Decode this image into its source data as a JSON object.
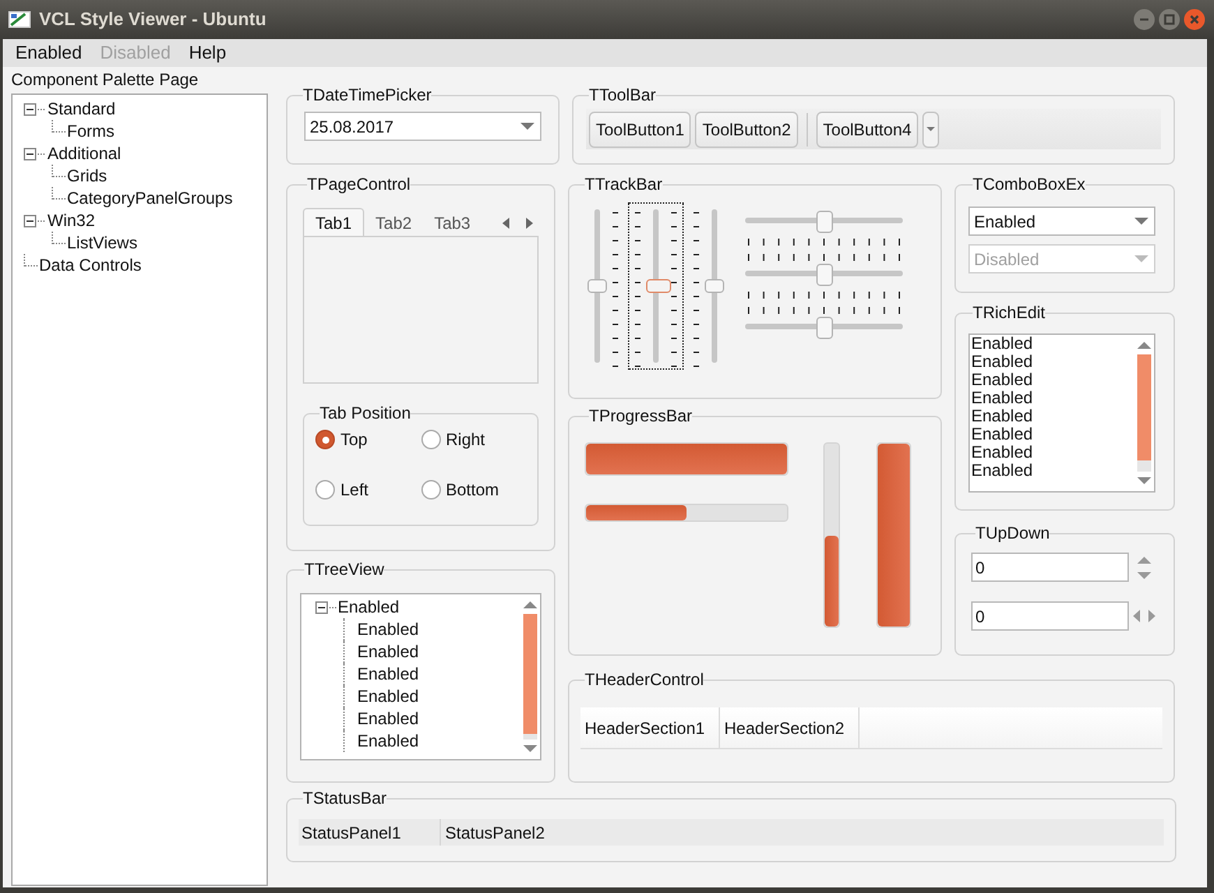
{
  "window": {
    "title": "VCL Style Viewer - Ubuntu"
  },
  "menu": [
    {
      "label": "Enabled",
      "disabled": false
    },
    {
      "label": "Disabled",
      "disabled": true
    },
    {
      "label": "Help",
      "disabled": false
    }
  ],
  "palette": {
    "label": "Component Palette Page",
    "tree": [
      {
        "label": "Standard",
        "expanded": true,
        "children": [
          {
            "label": "Forms"
          }
        ]
      },
      {
        "label": "Additional",
        "expanded": true,
        "children": [
          {
            "label": "Grids"
          },
          {
            "label": "CategoryPanelGroups"
          }
        ]
      },
      {
        "label": "Win32",
        "expanded": true,
        "children": [
          {
            "label": "ListViews"
          }
        ]
      },
      {
        "label": "Data Controls"
      }
    ]
  },
  "date_time_picker": {
    "title": "TDateTimePicker",
    "value": "25.08.2017"
  },
  "toolbar": {
    "title": "TToolBar",
    "items": [
      {
        "kind": "button",
        "label": "ToolButton1"
      },
      {
        "kind": "button",
        "label": "ToolButton2"
      },
      {
        "kind": "separator"
      },
      {
        "kind": "button",
        "label": "ToolButton4"
      },
      {
        "kind": "dropdown"
      }
    ]
  },
  "page_control": {
    "title": "TPageControl",
    "tabs": [
      {
        "label": "Tab1",
        "selected": true
      },
      {
        "label": "Tab2",
        "selected": false
      },
      {
        "label": "Tab3",
        "selected": false
      }
    ],
    "tab_position": {
      "title": "Tab Position",
      "options": [
        {
          "label": "Top",
          "selected": true
        },
        {
          "label": "Right",
          "selected": false
        },
        {
          "label": "Left",
          "selected": false
        },
        {
          "label": "Bottom",
          "selected": false
        }
      ]
    }
  },
  "tree_view": {
    "title": "TTreeView",
    "items": [
      {
        "label": "Enabled",
        "expanded": true,
        "children": [
          {
            "label": "Enabled"
          },
          {
            "label": "Enabled"
          },
          {
            "label": "Enabled"
          },
          {
            "label": "Enabled"
          },
          {
            "label": "Enabled"
          },
          {
            "label": "Enabled"
          }
        ]
      }
    ]
  },
  "track_bar": {
    "title": "TTrackBar",
    "vertical": [
      {
        "level": 0.5,
        "focused": false
      },
      {
        "level": 0.5,
        "focused": true
      },
      {
        "level": 0.5,
        "focused": false
      }
    ],
    "horizontal": [
      {
        "level": 0.5
      },
      {
        "level": 0.5
      },
      {
        "level": 0.5
      }
    ]
  },
  "progress_bar": {
    "title": "TProgressBar",
    "bars": [
      {
        "kind": "horizontal",
        "level": 1
      },
      {
        "kind": "horizontal",
        "level": 0.5
      },
      {
        "kind": "vertical",
        "level": 0.5
      },
      {
        "kind": "vertical",
        "level": 1
      }
    ]
  },
  "combo_box_ex": {
    "title": "TComboBoxEx",
    "boxes": [
      {
        "value": "Enabled",
        "disabled": false
      },
      {
        "value": "Disabled",
        "disabled": true
      }
    ]
  },
  "rich_edit": {
    "title": "TRichEdit",
    "lines": [
      "Enabled",
      "Enabled",
      "Enabled",
      "Enabled",
      "Enabled",
      "Enabled",
      "Enabled",
      "Enabled"
    ]
  },
  "up_down": {
    "title": "TUpDown",
    "fields": [
      {
        "value": "0",
        "kind": "vertical"
      },
      {
        "value": "0",
        "kind": "horizontal"
      }
    ]
  },
  "header_control": {
    "title": "THeaderControl",
    "sections": [
      "HeaderSection1",
      "HeaderSection2"
    ]
  },
  "status_bar": {
    "title": "TStatusBar",
    "panels": [
      "StatusPanel1",
      "StatusPanel2"
    ]
  }
}
